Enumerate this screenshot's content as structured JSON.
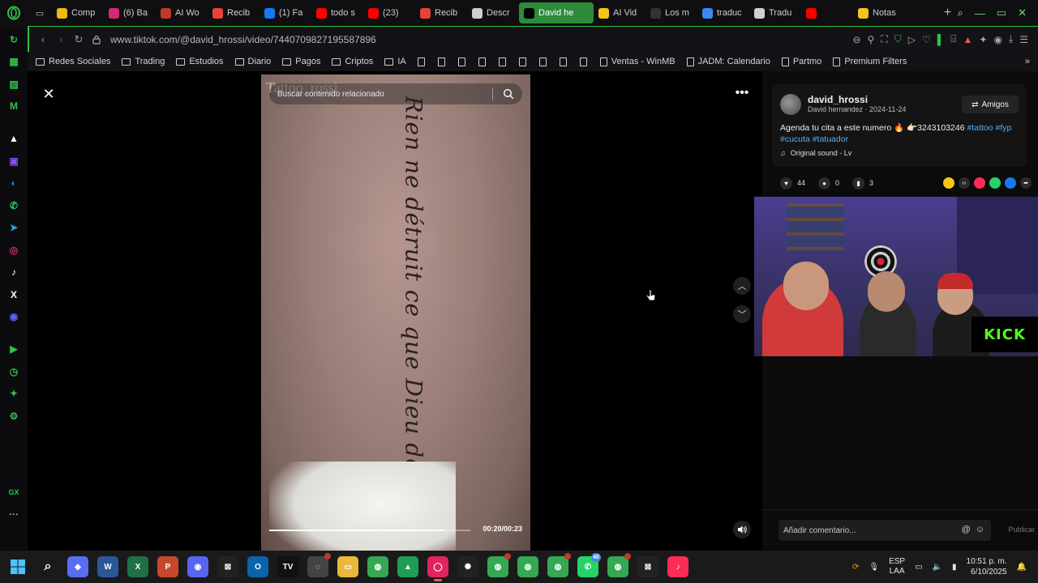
{
  "browser": {
    "tabs": [
      {
        "label": "Comp",
        "icon": "binance-icon",
        "color": "#f0b90b"
      },
      {
        "label": "(6) Ba",
        "icon": "instagram-icon",
        "color": "#d62976"
      },
      {
        "label": "AI Wo",
        "icon": "ai-icon",
        "color": "#c0392b"
      },
      {
        "label": "Recib",
        "icon": "gmail-icon",
        "color": "#ea4335"
      },
      {
        "label": "(1) Fa",
        "icon": "facebook-icon",
        "color": "#1877f2"
      },
      {
        "label": "todo s",
        "icon": "youtube-icon",
        "color": "#ff0000"
      },
      {
        "label": "(23)",
        "icon": "youtube-icon",
        "color": "#ff0000"
      },
      {
        "label": "Recib",
        "icon": "gmail-icon",
        "color": "#ea4335"
      },
      {
        "label": "Descr",
        "icon": "openai-icon",
        "color": "#cfcfcf"
      },
      {
        "label": "David he",
        "icon": "tiktok-icon",
        "color": "#000000",
        "active": true
      },
      {
        "label": "AI Vid",
        "icon": "ai-icon",
        "color": "#f5c518"
      },
      {
        "label": "Los m",
        "icon": "p-icon",
        "color": "#333333"
      },
      {
        "label": "traduc",
        "icon": "google-icon",
        "color": "#4285f4"
      },
      {
        "label": "Tradu",
        "icon": "openai-icon",
        "color": "#cfcfcf"
      },
      {
        "label": "",
        "icon": "youtube-icon",
        "color": "#ff0000"
      },
      {
        "label": "Notas",
        "icon": "notes-icon",
        "color": "#f5c518"
      }
    ],
    "url": "www.tiktok.com/@david_hrossi/video/7440709827195587896",
    "accent": "#2fc24a",
    "bookmarks": [
      {
        "label": "Redes Sociales",
        "type": "folder"
      },
      {
        "label": "Trading",
        "type": "folder"
      },
      {
        "label": "Estudios",
        "type": "folder"
      },
      {
        "label": "Diario",
        "type": "folder"
      },
      {
        "label": "Pagos",
        "type": "folder"
      },
      {
        "label": "Criptos",
        "type": "folder"
      },
      {
        "label": "IA",
        "type": "folder"
      },
      {
        "label": "",
        "type": "page"
      },
      {
        "label": "",
        "type": "page"
      },
      {
        "label": "",
        "type": "page"
      },
      {
        "label": "",
        "type": "page"
      },
      {
        "label": "",
        "type": "page"
      },
      {
        "label": "",
        "type": "page"
      },
      {
        "label": "",
        "type": "page"
      },
      {
        "label": "",
        "type": "page"
      },
      {
        "label": "",
        "type": "page"
      },
      {
        "label": "Ventas - WinMB",
        "type": "page"
      },
      {
        "label": "JADM: Calendario",
        "type": "page"
      },
      {
        "label": "Partmo",
        "type": "page"
      },
      {
        "label": "Premium Filters",
        "type": "page"
      }
    ]
  },
  "sidebar": {
    "items": [
      {
        "icon": "assistant-icon",
        "color": "#2fc24a",
        "glyph": "↻"
      },
      {
        "icon": "flow-icon",
        "color": "#2fc24a",
        "glyph": "▦"
      },
      {
        "icon": "crypto-wallet-icon",
        "color": "#2fc24a",
        "glyph": "▨"
      },
      {
        "icon": "m-icon",
        "color": "#2fc24a",
        "glyph": "M"
      },
      {
        "icon": "aria-icon",
        "color": "#1a1a1a",
        "glyph": "▲"
      },
      {
        "icon": "twitch-icon",
        "color": "#9146ff",
        "glyph": "▣"
      },
      {
        "icon": "messenger-icon",
        "color": "#0084ff",
        "glyph": "◐"
      },
      {
        "icon": "whatsapp-icon",
        "color": "#25d366",
        "glyph": "✆"
      },
      {
        "icon": "telegram-icon",
        "color": "#2aa3df",
        "glyph": "➤"
      },
      {
        "icon": "instagram-icon",
        "color": "#d62976",
        "glyph": "◎"
      },
      {
        "icon": "tiktok-icon",
        "color": "#111111",
        "glyph": "♪"
      },
      {
        "icon": "x-icon",
        "color": "#111111",
        "glyph": "X"
      },
      {
        "icon": "discord-icon",
        "color": "#5865f2",
        "glyph": "◉"
      },
      {
        "icon": "player-icon",
        "color": "#2fc24a",
        "glyph": "▶"
      },
      {
        "icon": "history-icon",
        "color": "#2fc24a",
        "glyph": "◷"
      },
      {
        "icon": "extensions-icon",
        "color": "#2fc24a",
        "glyph": "✦"
      },
      {
        "icon": "settings-icon",
        "color": "#2fc24a",
        "glyph": "⚙"
      }
    ],
    "gx_label": "GX"
  },
  "video": {
    "watermark": "Tattoo_rossi",
    "search_placeholder": "Buscar contenido relacionado",
    "tattoo_text": "Rien ne détruit ce que Dieu détient",
    "time": "00:20/00:23",
    "progress": 0.87
  },
  "post": {
    "username": "david_hrossi",
    "subline": "David hernandez · 2024-11-24",
    "friends_label": "Amigos",
    "caption_text": "Agenda tu cita a este numero 🔥 👉🏻3243103246 ",
    "hashtags": [
      "#tattoo",
      "#fyp",
      "#cucuta",
      "#tatuador"
    ],
    "sound": "Original sound - Lv",
    "likes": "44",
    "comments": "0",
    "saves": "3",
    "share_icons": [
      {
        "icon": "coin-icon",
        "color": "#f5c518"
      },
      {
        "icon": "embed-icon",
        "color": "#2a2a2a"
      },
      {
        "icon": "send-icon",
        "color": "#fe2c55"
      },
      {
        "icon": "whatsapp-icon",
        "color": "#25d366"
      },
      {
        "icon": "facebook-icon",
        "color": "#1877f2"
      },
      {
        "icon": "share-arrow-icon",
        "color": "#2a2a2a"
      }
    ],
    "comment_placeholder": "Añadir comentario...",
    "publish_label": "Publicar"
  },
  "stream": {
    "brand": "KICK",
    "brand_color": "#53fc18"
  },
  "taskbar": {
    "apps": [
      {
        "icon": "search-icon",
        "color": "transparent",
        "glyph": "⌕"
      },
      {
        "icon": "copilot-icon",
        "color": "#5a6df0",
        "glyph": "◆"
      },
      {
        "icon": "word-icon",
        "color": "#2b5797",
        "glyph": "W"
      },
      {
        "icon": "excel-icon",
        "color": "#1e7145",
        "glyph": "X"
      },
      {
        "icon": "powerpoint-icon",
        "color": "#c8472b",
        "glyph": "P"
      },
      {
        "icon": "discord-icon",
        "color": "#5865f2",
        "glyph": "◉"
      },
      {
        "icon": "capcut-icon",
        "color": "#222222",
        "glyph": "⊠"
      },
      {
        "icon": "outlook-icon",
        "color": "#0a64ad",
        "glyph": "O"
      },
      {
        "icon": "tradingview-icon",
        "color": "#111111",
        "glyph": "TV"
      },
      {
        "icon": "app-icon",
        "color": "#444444",
        "glyph": "◌",
        "badge": ""
      },
      {
        "icon": "file-explorer-icon",
        "color": "#e8b93a",
        "glyph": "▭"
      },
      {
        "icon": "chrome-icon",
        "color": "#34a853",
        "glyph": "◍"
      },
      {
        "icon": "drive-icon",
        "color": "#1f9d55",
        "glyph": "▲"
      },
      {
        "icon": "opera-gx-icon",
        "color": "#e0245e",
        "glyph": "◯",
        "active": true
      },
      {
        "icon": "chatgpt-icon",
        "color": "#222222",
        "glyph": "✺"
      },
      {
        "icon": "chrome-profile-icon",
        "color": "#34a853",
        "glyph": "◍",
        "badge": ""
      },
      {
        "icon": "chrome-profile-icon",
        "color": "#34a853",
        "glyph": "◍"
      },
      {
        "icon": "chrome-profile-icon",
        "color": "#34a853",
        "glyph": "◍",
        "badge": ""
      },
      {
        "icon": "whatsapp-icon",
        "color": "#25d366",
        "glyph": "✆",
        "badge": "40"
      },
      {
        "icon": "chrome-profile-icon",
        "color": "#34a853",
        "glyph": "◍",
        "badge": ""
      },
      {
        "icon": "capcut-icon",
        "color": "#222222",
        "glyph": "⊠"
      },
      {
        "icon": "tiktok-icon",
        "color": "#fe2c55",
        "glyph": "♪"
      }
    ],
    "lang_top": "ESP",
    "lang_bottom": "LAA",
    "time": "10:51 p. m.",
    "date": "6/10/2025"
  }
}
